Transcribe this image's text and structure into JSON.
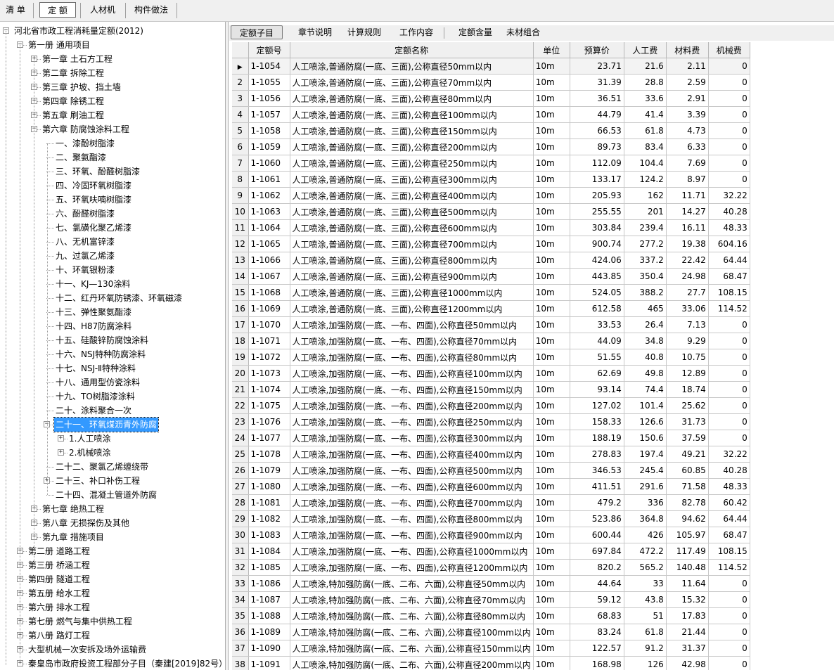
{
  "toolbar": {
    "buttons": [
      "清 单",
      "定 额",
      "人材机",
      "构件做法"
    ],
    "active": "定 额"
  },
  "tree": {
    "root": "河北省市政工程消耗量定额(2012)",
    "volume1": "第一册 通用项目",
    "chapters": [
      "第一章 土石方工程",
      "第二章 拆除工程",
      "第三章 护坡、挡土墙",
      "第四章 除锈工程",
      "第五章 刷油工程",
      "第六章 防腐蚀涂料工程"
    ],
    "sections": [
      "一、漆酚树脂漆",
      "二、聚氨酯漆",
      "三、环氧、酚醛树脂漆",
      "四、冷固环氧树脂漆",
      "五、环氧呋喃树脂漆",
      "六、酚醛树脂漆",
      "七、氯磺化聚乙烯漆",
      "八、无机富锌漆",
      "九、过氯乙烯漆",
      "十、环氧银粉漆",
      "十一、KJ—130涂料",
      "十二、红丹环氧防锈漆、环氧磁漆",
      "十三、弹性聚氨酯漆",
      "十四、H87防腐涂料",
      "十五、硅酸锌防腐蚀涂料",
      "十六、NSJ特种防腐涂料",
      "十七、NSJ-Ⅱ特种涂料",
      "十八、通用型仿瓷涂料",
      "十九、TO树脂漆涂料",
      "二十、涂料聚合一次"
    ],
    "selected": "二十一、环氧煤沥青外防腐",
    "subs": [
      "1.人工喷涂",
      "2.机械喷涂"
    ],
    "after_selected": [
      "二十二、聚氯乙烯缠绕带",
      "二十三、补口补伤工程",
      "二十四、混凝土管道外防腐"
    ],
    "chapters_b": [
      "第七章 绝热工程",
      "第八章 无损探伤及其他",
      "第九章 措施项目"
    ],
    "volumes": [
      "第二册 道路工程",
      "第三册 桥涵工程",
      "第四册 隧道工程",
      "第五册 给水工程",
      "第六册 排水工程",
      "第七册 燃气与集中供热工程",
      "第八册 路灯工程",
      "大型机械一次安拆及场外运输费",
      "秦皇岛市政府投资工程部分子目（秦建[2019]82号）"
    ]
  },
  "tabs": {
    "items": [
      "定额子目",
      "章节说明",
      "计算规则",
      "工作内容",
      "定额含量",
      "未材组合"
    ],
    "active": "定额子目"
  },
  "grid": {
    "columns": [
      "定额号",
      "定额名称",
      "单位",
      "预算价",
      "人工费",
      "材料费",
      "机械费"
    ],
    "rows": [
      [
        "1-1054",
        "人工喷涂,普通防腐(一底、三面),公称直径50mm以内",
        "10m",
        "23.71",
        "21.6",
        "2.11",
        "0"
      ],
      [
        "1-1055",
        "人工喷涂,普通防腐(一底、三面),公称直径70mm以内",
        "10m",
        "31.39",
        "28.8",
        "2.59",
        "0"
      ],
      [
        "1-1056",
        "人工喷涂,普通防腐(一底、三面),公称直径80mm以内",
        "10m",
        "36.51",
        "33.6",
        "2.91",
        "0"
      ],
      [
        "1-1057",
        "人工喷涂,普通防腐(一底、三面),公称直径100mm以内",
        "10m",
        "44.79",
        "41.4",
        "3.39",
        "0"
      ],
      [
        "1-1058",
        "人工喷涂,普通防腐(一底、三面),公称直径150mm以内",
        "10m",
        "66.53",
        "61.8",
        "4.73",
        "0"
      ],
      [
        "1-1059",
        "人工喷涂,普通防腐(一底、三面),公称直径200mm以内",
        "10m",
        "89.73",
        "83.4",
        "6.33",
        "0"
      ],
      [
        "1-1060",
        "人工喷涂,普通防腐(一底、三面),公称直径250mm以内",
        "10m",
        "112.09",
        "104.4",
        "7.69",
        "0"
      ],
      [
        "1-1061",
        "人工喷涂,普通防腐(一底、三面),公称直径300mm以内",
        "10m",
        "133.17",
        "124.2",
        "8.97",
        "0"
      ],
      [
        "1-1062",
        "人工喷涂,普通防腐(一底、三面),公称直径400mm以内",
        "10m",
        "205.93",
        "162",
        "11.71",
        "32.22"
      ],
      [
        "1-1063",
        "人工喷涂,普通防腐(一底、三面),公称直径500mm以内",
        "10m",
        "255.55",
        "201",
        "14.27",
        "40.28"
      ],
      [
        "1-1064",
        "人工喷涂,普通防腐(一底、三面),公称直径600mm以内",
        "10m",
        "303.84",
        "239.4",
        "16.11",
        "48.33"
      ],
      [
        "1-1065",
        "人工喷涂,普通防腐(一底、三面),公称直径700mm以内",
        "10m",
        "900.74",
        "277.2",
        "19.38",
        "604.16"
      ],
      [
        "1-1066",
        "人工喷涂,普通防腐(一底、三面),公称直径800mm以内",
        "10m",
        "424.06",
        "337.2",
        "22.42",
        "64.44"
      ],
      [
        "1-1067",
        "人工喷涂,普通防腐(一底、三面),公称直径900mm以内",
        "10m",
        "443.85",
        "350.4",
        "24.98",
        "68.47"
      ],
      [
        "1-1068",
        "人工喷涂,普通防腐(一底、三面),公称直径1000mm以内",
        "10m",
        "524.05",
        "388.2",
        "27.7",
        "108.15"
      ],
      [
        "1-1069",
        "人工喷涂,普通防腐(一底、三面),公称直径1200mm以内",
        "10m",
        "612.58",
        "465",
        "33.06",
        "114.52"
      ],
      [
        "1-1070",
        "人工喷涂,加强防腐(一底、一布、四面),公称直径50mm以内",
        "10m",
        "33.53",
        "26.4",
        "7.13",
        "0"
      ],
      [
        "1-1071",
        "人工喷涂,加强防腐(一底、一布、四面),公称直径70mm以内",
        "10m",
        "44.09",
        "34.8",
        "9.29",
        "0"
      ],
      [
        "1-1072",
        "人工喷涂,加强防腐(一底、一布、四面),公称直径80mm以内",
        "10m",
        "51.55",
        "40.8",
        "10.75",
        "0"
      ],
      [
        "1-1073",
        "人工喷涂,加强防腐(一底、一布、四面),公称直径100mm以内",
        "10m",
        "62.69",
        "49.8",
        "12.89",
        "0"
      ],
      [
        "1-1074",
        "人工喷涂,加强防腐(一底、一布、四面),公称直径150mm以内",
        "10m",
        "93.14",
        "74.4",
        "18.74",
        "0"
      ],
      [
        "1-1075",
        "人工喷涂,加强防腐(一底、一布、四面),公称直径200mm以内",
        "10m",
        "127.02",
        "101.4",
        "25.62",
        "0"
      ],
      [
        "1-1076",
        "人工喷涂,加强防腐(一底、一布、四面),公称直径250mm以内",
        "10m",
        "158.33",
        "126.6",
        "31.73",
        "0"
      ],
      [
        "1-1077",
        "人工喷涂,加强防腐(一底、一布、四面),公称直径300mm以内",
        "10m",
        "188.19",
        "150.6",
        "37.59",
        "0"
      ],
      [
        "1-1078",
        "人工喷涂,加强防腐(一底、一布、四面),公称直径400mm以内",
        "10m",
        "278.83",
        "197.4",
        "49.21",
        "32.22"
      ],
      [
        "1-1079",
        "人工喷涂,加强防腐(一底、一布、四面),公称直径500mm以内",
        "10m",
        "346.53",
        "245.4",
        "60.85",
        "40.28"
      ],
      [
        "1-1080",
        "人工喷涂,加强防腐(一底、一布、四面),公称直径600mm以内",
        "10m",
        "411.51",
        "291.6",
        "71.58",
        "48.33"
      ],
      [
        "1-1081",
        "人工喷涂,加强防腐(一底、一布、四面),公称直径700mm以内",
        "10m",
        "479.2",
        "336",
        "82.78",
        "60.42"
      ],
      [
        "1-1082",
        "人工喷涂,加强防腐(一底、一布、四面),公称直径800mm以内",
        "10m",
        "523.86",
        "364.8",
        "94.62",
        "64.44"
      ],
      [
        "1-1083",
        "人工喷涂,加强防腐(一底、一布、四面),公称直径900mm以内",
        "10m",
        "600.44",
        "426",
        "105.97",
        "68.47"
      ],
      [
        "1-1084",
        "人工喷涂,加强防腐(一底、一布、四面),公称直径1000mm以内",
        "10m",
        "697.84",
        "472.2",
        "117.49",
        "108.15"
      ],
      [
        "1-1085",
        "人工喷涂,加强防腐(一底、一布、四面),公称直径1200mm以内",
        "10m",
        "820.2",
        "565.2",
        "140.48",
        "114.52"
      ],
      [
        "1-1086",
        "人工喷涂,特加强防腐(一底、二布、六面),公称直径50mm以内",
        "10m",
        "44.64",
        "33",
        "11.64",
        "0"
      ],
      [
        "1-1087",
        "人工喷涂,特加强防腐(一底、二布、六面),公称直径70mm以内",
        "10m",
        "59.12",
        "43.8",
        "15.32",
        "0"
      ],
      [
        "1-1088",
        "人工喷涂,特加强防腐(一底、二布、六面),公称直径80mm以内",
        "10m",
        "68.83",
        "51",
        "17.83",
        "0"
      ],
      [
        "1-1089",
        "人工喷涂,特加强防腐(一底、二布、六面),公称直径100mm以内",
        "10m",
        "83.24",
        "61.8",
        "21.44",
        "0"
      ],
      [
        "1-1090",
        "人工喷涂,特加强防腐(一底、二布、六面),公称直径150mm以内",
        "10m",
        "122.57",
        "91.2",
        "31.37",
        "0"
      ],
      [
        "1-1091",
        "人工喷涂,特加强防腐(一底、二布、六面),公称直径200mm以内",
        "10m",
        "168.98",
        "126",
        "42.98",
        "0"
      ]
    ]
  },
  "colors": {
    "selection": "#3399ff",
    "panel": "#f0f0f0",
    "grid_line": "#c8c8c8"
  }
}
